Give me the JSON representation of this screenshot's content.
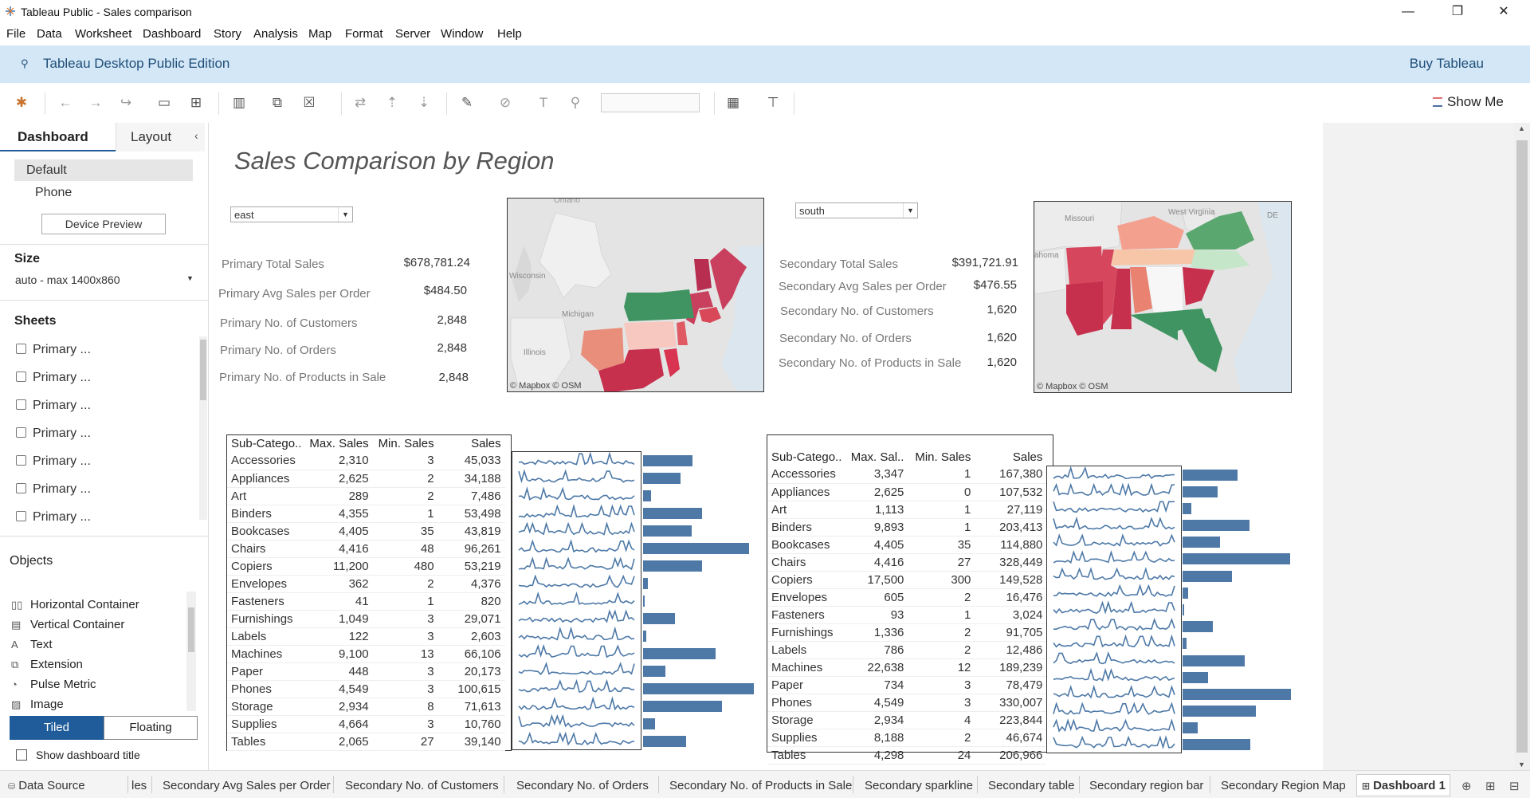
{
  "window": {
    "title": "Tableau Public - Sales comparison",
    "minimize": "—",
    "restore": "❐",
    "close": "✕"
  },
  "menu": [
    "File",
    "Data",
    "Worksheet",
    "Dashboard",
    "Story",
    "Analysis",
    "Map",
    "Format",
    "Server",
    "Window",
    "Help"
  ],
  "edition": {
    "title": "Tableau Desktop Public Edition",
    "buy": "Buy Tableau"
  },
  "toolbar": {
    "show_me": "Show Me"
  },
  "sidebar": {
    "tabs": {
      "dashboard": "Dashboard",
      "layout": "Layout"
    },
    "devices": {
      "default": "Default",
      "phone": "Phone",
      "preview": "Device Preview"
    },
    "size": {
      "header": "Size",
      "value": "auto - max 1400x860"
    },
    "sheets": {
      "header": "Sheets",
      "items": [
        "Primary ...",
        "Primary ...",
        "Primary ...",
        "Primary ...",
        "Primary ...",
        "Primary ...",
        "Primary ..."
      ]
    },
    "objects": {
      "header": "Objects",
      "items": [
        {
          "label": "Horizontal Container",
          "icon": "▯▯"
        },
        {
          "label": "Vertical Container",
          "icon": "▤"
        },
        {
          "label": "Text",
          "icon": "A"
        },
        {
          "label": "Extension",
          "icon": "⧉"
        },
        {
          "label": "Pulse Metric",
          "icon": "◔"
        },
        {
          "label": "Image",
          "icon": "▨"
        }
      ]
    },
    "tiled": "Tiled",
    "floating": "Floating",
    "show_title": "Show dashboard title"
  },
  "dashboard": {
    "title": "Sales Comparison by Region",
    "primary": {
      "region": "east",
      "kpis": [
        {
          "label": "Primary Total Sales",
          "value": "$678,781.24"
        },
        {
          "label": "Primary Avg Sales per Order",
          "value": "$484.50"
        },
        {
          "label": "Primary No. of Customers",
          "value": "2,848"
        },
        {
          "label": "Primary No. of Orders",
          "value": "2,848"
        },
        {
          "label": "Primary No. of Products in Sale",
          "value": "2,848"
        }
      ],
      "map_labels": [
        "Ontario",
        "Wisconsin",
        "Michigan",
        "Illinois"
      ],
      "map_credit": "© Mapbox © OSM"
    },
    "secondary": {
      "region": "south",
      "kpis": [
        {
          "label": "Secondary Total Sales",
          "value": "$391,721.91"
        },
        {
          "label": "Secondary Avg Sales per Order",
          "value": "$476.55"
        },
        {
          "label": "Secondary No. of Customers",
          "value": "1,620"
        },
        {
          "label": "Secondary No. of Orders",
          "value": "1,620"
        },
        {
          "label": "Secondary No. of Products in Sale",
          "value": "1,620"
        }
      ],
      "map_labels": [
        "Missouri",
        "West Virginia",
        "DE",
        "ahoma"
      ],
      "map_credit": "© Mapbox © OSM"
    }
  },
  "chart_data": [
    {
      "type": "table",
      "title": "",
      "columns": [
        "Sub-Catego..",
        "Max. Sales",
        "Min. Sales",
        "Sales"
      ],
      "rows": [
        [
          "Accessories",
          "2,310",
          "3",
          "45,033"
        ],
        [
          "Appliances",
          "2,625",
          "2",
          "34,188"
        ],
        [
          "Art",
          "289",
          "2",
          "7,486"
        ],
        [
          "Binders",
          "4,355",
          "1",
          "53,498"
        ],
        [
          "Bookcases",
          "4,405",
          "35",
          "43,819"
        ],
        [
          "Chairs",
          "4,416",
          "48",
          "96,261"
        ],
        [
          "Copiers",
          "11,200",
          "480",
          "53,219"
        ],
        [
          "Envelopes",
          "362",
          "2",
          "4,376"
        ],
        [
          "Fasteners",
          "41",
          "1",
          "820"
        ],
        [
          "Furnishings",
          "1,049",
          "3",
          "29,071"
        ],
        [
          "Labels",
          "122",
          "3",
          "2,603"
        ],
        [
          "Machines",
          "9,100",
          "13",
          "66,106"
        ],
        [
          "Paper",
          "448",
          "3",
          "20,173"
        ],
        [
          "Phones",
          "4,549",
          "3",
          "100,615"
        ],
        [
          "Storage",
          "2,934",
          "8",
          "71,613"
        ],
        [
          "Supplies",
          "4,664",
          "3",
          "10,760"
        ],
        [
          "Tables",
          "2,065",
          "27",
          "39,140"
        ]
      ],
      "bar_values": [
        45033,
        34188,
        7486,
        53498,
        43819,
        96261,
        53219,
        4376,
        820,
        29071,
        2603,
        66106,
        20173,
        100615,
        71613,
        10760,
        39140
      ]
    },
    {
      "type": "table",
      "title": "",
      "columns": [
        "Sub-Catego..",
        "Max. Sal..",
        "Min. Sales",
        "Sales"
      ],
      "rows": [
        [
          "Accessories",
          "3,347",
          "1",
          "167,380"
        ],
        [
          "Appliances",
          "2,625",
          "0",
          "107,532"
        ],
        [
          "Art",
          "1,113",
          "1",
          "27,119"
        ],
        [
          "Binders",
          "9,893",
          "1",
          "203,413"
        ],
        [
          "Bookcases",
          "4,405",
          "35",
          "114,880"
        ],
        [
          "Chairs",
          "4,416",
          "27",
          "328,449"
        ],
        [
          "Copiers",
          "17,500",
          "300",
          "149,528"
        ],
        [
          "Envelopes",
          "605",
          "2",
          "16,476"
        ],
        [
          "Fasteners",
          "93",
          "1",
          "3,024"
        ],
        [
          "Furnishings",
          "1,336",
          "2",
          "91,705"
        ],
        [
          "Labels",
          "786",
          "2",
          "12,486"
        ],
        [
          "Machines",
          "22,638",
          "12",
          "189,239"
        ],
        [
          "Paper",
          "734",
          "3",
          "78,479"
        ],
        [
          "Phones",
          "4,549",
          "3",
          "330,007"
        ],
        [
          "Storage",
          "2,934",
          "4",
          "223,844"
        ],
        [
          "Supplies",
          "8,188",
          "2",
          "46,674"
        ],
        [
          "Tables",
          "4,298",
          "24",
          "206,966"
        ]
      ],
      "bar_values": [
        167380,
        107532,
        27119,
        203413,
        114880,
        328449,
        149528,
        16476,
        3024,
        91705,
        12486,
        189239,
        78479,
        330007,
        223844,
        46674,
        206966
      ]
    }
  ],
  "bottom_tabs": [
    "Data Source",
    "les",
    "Secondary Avg Sales per Order",
    "Secondary No. of Customers",
    "Secondary No. of Orders",
    "Secondary No. of Products in Sale",
    "Secondary sparkline",
    "Secondary table",
    "Secondary region bar",
    "Secondary Region Map",
    "Dashboard 1"
  ],
  "colors": {
    "bar": "#4e79a7",
    "accent": "#1f5c99",
    "edition_bg": "#d3e7f7"
  }
}
